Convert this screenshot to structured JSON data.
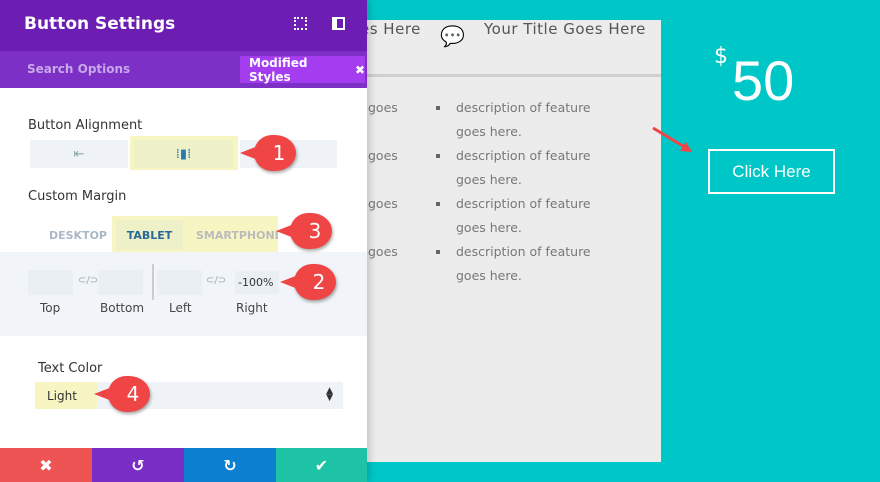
{
  "panel": {
    "title": "Button Settings",
    "search_placeholder": "Search Options",
    "modified_styles": "Modified Styles",
    "close_glyph": "✖",
    "button_alignment": {
      "label": "Button Alignment",
      "options": [
        "left",
        "center",
        "right"
      ],
      "selected": "center"
    },
    "custom_margin": {
      "label": "Custom Margin",
      "tabs": [
        "DESKTOP",
        "TABLET",
        "SMARTPHONE"
      ],
      "active_tab": "TABLET",
      "fields": [
        {
          "label": "Top",
          "value": ""
        },
        {
          "label": "Bottom",
          "value": ""
        },
        {
          "label": "Left",
          "value": ""
        },
        {
          "label": "Right",
          "value": "-100%"
        }
      ]
    },
    "text_color": {
      "label": "Text Color",
      "value": "Light"
    },
    "footer": {
      "cancel": "✖",
      "undo": "↺",
      "redo": "↻",
      "save": "✔"
    }
  },
  "preview": {
    "title_partial": "es Here",
    "title": "Your Title Goes Here",
    "left_col_partial": "goes",
    "features": [
      "description of feature goes here.",
      "description of feature goes here.",
      "description of feature goes here.",
      "description of feature goes here."
    ],
    "price_currency": "$",
    "price": "50",
    "cta": "Click Here"
  },
  "annotations": [
    "1",
    "2",
    "3",
    "4"
  ],
  "colors": {
    "teal": "#00c7c7",
    "purple": "#6c1eb2",
    "accent": "#a43cf0",
    "marker": "#f04545"
  }
}
